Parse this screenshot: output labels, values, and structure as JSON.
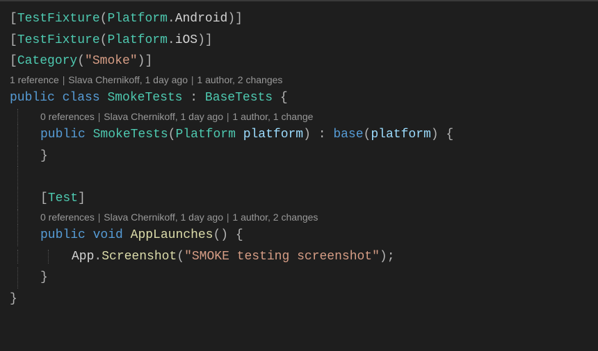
{
  "code": {
    "attr1": {
      "open": "[",
      "name": "TestFixture",
      "lp": "(",
      "arg1": "Platform",
      "dot": ".",
      "arg2": "Android",
      "rp": ")",
      "close": "]"
    },
    "attr2": {
      "open": "[",
      "name": "TestFixture",
      "lp": "(",
      "arg1": "Platform",
      "dot": ".",
      "arg2": "iOS",
      "rp": ")",
      "close": "]"
    },
    "attr3": {
      "open": "[",
      "name": "Category",
      "lp": "(",
      "str": "\"Smoke\"",
      "rp": ")",
      "close": "]"
    },
    "classdecl": {
      "kw1": "public",
      "kw2": "class",
      "name": "SmokeTests",
      "colon": " : ",
      "base": "BaseTests",
      "brace": " {"
    },
    "ctor": {
      "kw": "public",
      "name": "SmokeTests",
      "lp": "(",
      "ptype": "Platform",
      "pname": " platform",
      "rp": ")",
      "colon": " : ",
      "basekw": "base",
      "blp": "(",
      "barg": "platform",
      "brp": ")",
      "brace": " {"
    },
    "ctor_close": "}",
    "test_attr": {
      "open": "[",
      "name": "Test",
      "close": "]"
    },
    "method": {
      "kw1": "public",
      "kw2": "void",
      "name": "AppLaunches",
      "lp": "(",
      "rp": ")",
      "brace": " {"
    },
    "call": {
      "obj": "App",
      "dot": ".",
      "m": "Screenshot",
      "lp": "(",
      "str": "\"SMOKE testing screenshot\"",
      "rp": ")",
      "semi": ";"
    },
    "method_close": "}",
    "class_close": "}"
  },
  "codelens": {
    "sep": " | ",
    "cl1": {
      "refs": "1 reference",
      "author": "Slava Chernikoff, 1 day ago",
      "changes": "1 author, 2 changes"
    },
    "cl2": {
      "refs": "0 references",
      "author": "Slava Chernikoff, 1 day ago",
      "changes": "1 author, 1 change"
    },
    "cl3": {
      "refs": "0 references",
      "author": "Slava Chernikoff, 1 day ago",
      "changes": "1 author, 2 changes"
    }
  }
}
